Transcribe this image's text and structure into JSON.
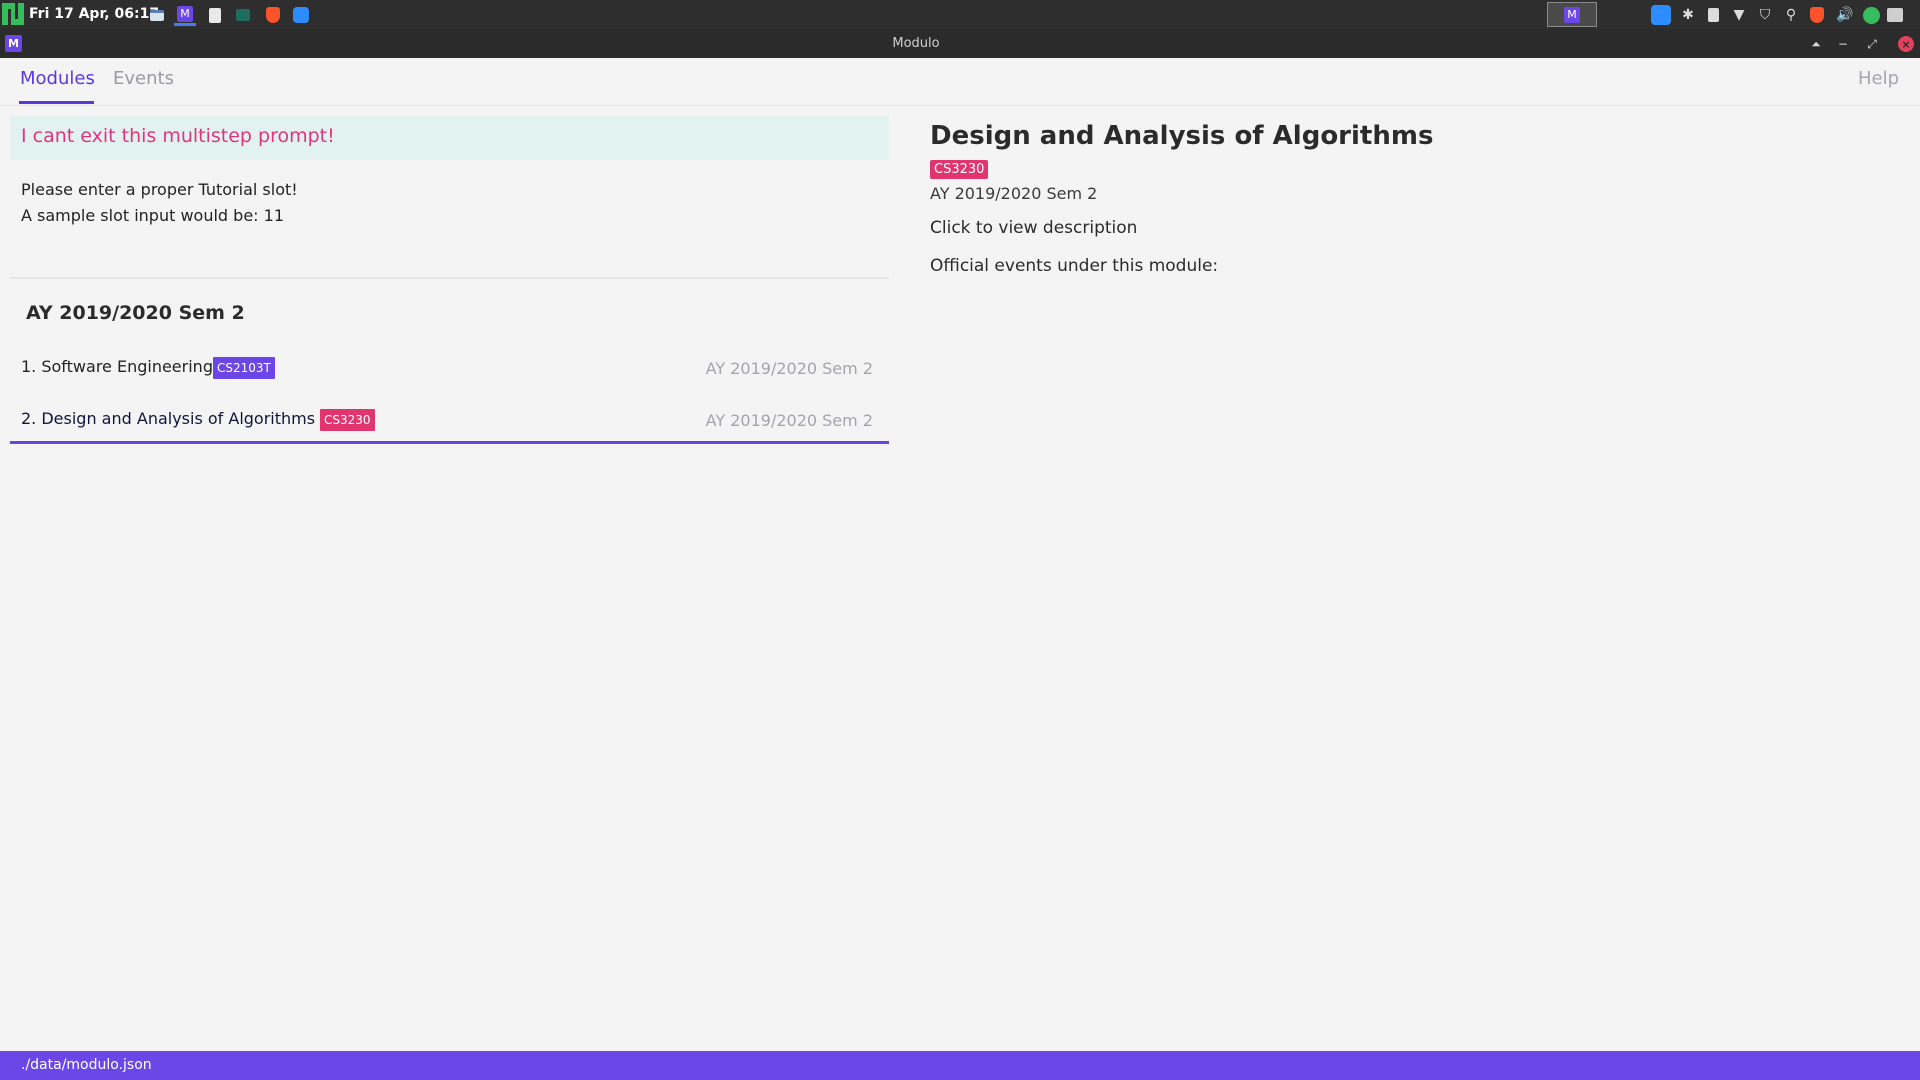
{
  "taskbar": {
    "clock": "Fri 17 Apr, 06:17",
    "pager_label": "M",
    "apps": [
      "files",
      "modulo",
      "document",
      "terminal",
      "brave",
      "zoom"
    ]
  },
  "window": {
    "title": "Modulo",
    "app_icon_label": "M"
  },
  "tabs": [
    {
      "label": "Modules",
      "active": true
    },
    {
      "label": "Events",
      "active": false
    }
  ],
  "help_label": "Help",
  "alert": "I cant exit this multistep prompt!",
  "feedback": {
    "line1": "Please enter a proper Tutorial slot!",
    "line2": "A sample slot input would be: 11"
  },
  "semester_heading": "AY 2019/2020 Sem 2",
  "modules": [
    {
      "name": "1. Software Engineering",
      "code": "CS2103T",
      "code_color": "#6b47e8",
      "semester": "AY 2019/2020 Sem 2"
    },
    {
      "name": "2. Design and Analysis of Algorithms",
      "code": "CS3230",
      "code_color": "#e0356e",
      "semester": "AY 2019/2020 Sem 2"
    }
  ],
  "detail": {
    "title": "Design and Analysis of Algorithms",
    "code": "CS3230",
    "semester": "AY 2019/2020 Sem 2",
    "description_link": "Click to view description",
    "events_heading": "Official events under this module:"
  },
  "status": "./data/modulo.json",
  "colors": {
    "accent": "#6b47e8",
    "alert_text": "#e0357e",
    "alert_bg": "#e2f2f1"
  }
}
